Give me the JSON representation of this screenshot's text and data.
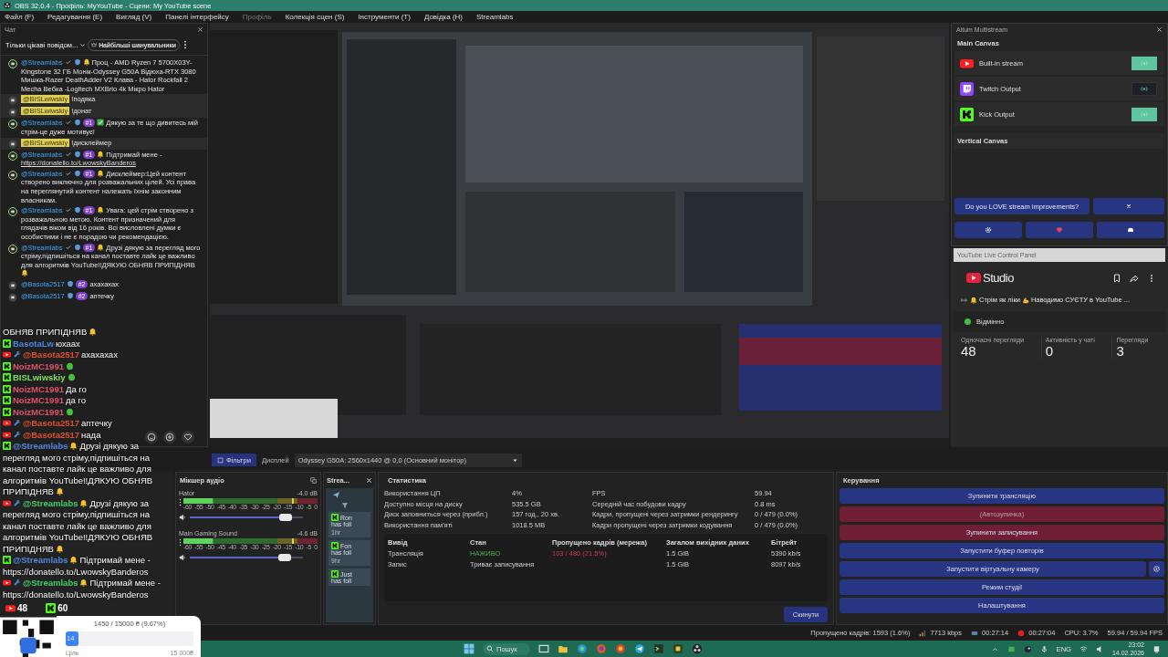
{
  "window": {
    "title": "OBS 32.0.4 - Профіль: MyYouTube - Сцени: My YouTube scene"
  },
  "menu": [
    {
      "label": "Файл (F)",
      "disabled": false
    },
    {
      "label": "Редагування (E)",
      "disabled": false
    },
    {
      "label": "Вигляд (V)",
      "disabled": false
    },
    {
      "label": "Панелі інтерфейсу",
      "disabled": false
    },
    {
      "label": "Профіль",
      "disabled": true
    },
    {
      "label": "Колекція сцен (S)",
      "disabled": false
    },
    {
      "label": "Інструменти (T)",
      "disabled": false
    },
    {
      "label": "Довідка (H)",
      "disabled": false
    },
    {
      "label": "Streamlabs",
      "disabled": false
    }
  ],
  "chat": {
    "title": "Чат",
    "filter": "Тільки цікаві повідом...",
    "chip": "Найбільші шанувальники",
    "messages": [
      {
        "kind": "bot",
        "name": "@Streamlabs",
        "bell": true,
        "text": "Проц - AMD Ryzen 7 5700X03Y-Kingstone 32 ГБ Монік-Odyssey G50A Відюха-RTX 3080 Мишка-Razer DeathAdder V2 Клава - Hator Rockfall 2 Mecha Вебка -Logitech MXBrio 4k Мікро Hator"
      },
      {
        "kind": "viewer",
        "name": "@BISLwiwskiy",
        "text": "!подяка"
      },
      {
        "kind": "viewer",
        "name": "@BISLwiwskiy",
        "text": "!донат"
      },
      {
        "kind": "bot",
        "name": "@Streamlabs",
        "badge": "#1",
        "tick": true,
        "text": "Дякую за те що дивитесь мій стрім-це дуже мотивує!"
      },
      {
        "kind": "viewer",
        "name": "@BISLwiwskiy",
        "text": "!дисклеймер"
      },
      {
        "kind": "bot",
        "name": "@Streamlabs",
        "badge": "#1",
        "bell": true,
        "text": "Підтримай мене -",
        "link": "https://donatello.to/LwowskyBanderos"
      },
      {
        "kind": "bot",
        "name": "@Streamlabs",
        "badge": "#1",
        "bell": true,
        "text": "Дисклеймер:Цей контент створено виключно для розважальних цілей. Усі права на переглянутий контент належать їхнім законним власникам."
      },
      {
        "kind": "bot",
        "name": "@Streamlabs",
        "badge": "#1",
        "bell": true,
        "text": "Увага: цей стрім створено з розважальною метою. Контент призначений для глядачів віком від 16 років. Всі висловлені думки є особистими і не є порадою чи рекомендацією."
      },
      {
        "kind": "bot",
        "name": "@Streamlabs",
        "badge": "#1",
        "bell": true,
        "text": "Друзі дякую за перегляд мого стріму,підпишіться на канал поставте лайк це важливо для алгоритмів YouTube!!ДЯКУЮ ОБНЯВ ПРИПІДНЯВ",
        "bell_end": true
      },
      {
        "kind": "member",
        "name": "@Basota2517",
        "badge": "#2",
        "text": "ахахахах"
      },
      {
        "kind": "member",
        "name": "@Basota2517",
        "badge": "#2",
        "text": "аптечку"
      }
    ]
  },
  "overlay": {
    "lines": [
      {
        "kind": "plain",
        "text": "ОБНЯВ ПРИПІДНЯВ",
        "bell_end": true
      },
      {
        "kind": "kick",
        "name": "BasotaLw",
        "color": "#4f86e0",
        "text": "юхаах"
      },
      {
        "kind": "youtube",
        "mod": true,
        "name": "@Basota2517",
        "color": "#e0502a",
        "text": "ахахахах"
      },
      {
        "kind": "kick",
        "name": "NoizMC1991",
        "color": "#e0506e",
        "sticker": true
      },
      {
        "kind": "kick",
        "name": "BISLwiwskiy",
        "color": "#7fe05a",
        "sticker": true
      },
      {
        "kind": "kick",
        "name": "NoizMC1991",
        "color": "#e0506e",
        "text": "Да го"
      },
      {
        "kind": "kick",
        "name": "NoizMC1991",
        "color": "#e0506e",
        "text": "да го"
      },
      {
        "kind": "kick",
        "name": "NoizMC1991",
        "color": "#e0506e",
        "sticker": true
      },
      {
        "kind": "youtube",
        "mod": true,
        "name": "@Basota2517",
        "color": "#e0502a",
        "text": "аптечку"
      },
      {
        "kind": "youtube",
        "mod": true,
        "name": "@Basota2517",
        "color": "#e0502a",
        "text": "нада"
      },
      {
        "kind": "kick",
        "name": "@Streamlabs",
        "color": "#4f86e0",
        "bell": true,
        "text": "Друзі дякую за перегляд мого стріму,підпишіться на канал поставте лайк це важливо для алгоритмів YouTube!!ДЯКУЮ ОБНЯВ ПРИПІДНЯВ",
        "bell_end": true
      },
      {
        "kind": "youtube",
        "mod": true,
        "name": "@Streamlabs",
        "color": "#3fcf6a",
        "bell": true,
        "text": "Друзі дякую за перегляд мого стріму,підпишіться на канал поставте лайк це важливо для алгоритмів YouTube!!ДЯКУЮ ОБНЯВ ПРИПІДНЯВ",
        "bell_end": true
      },
      {
        "kind": "kick",
        "name": "@Streamlabs",
        "color": "#4f86e0",
        "bell": true,
        "text": "Підтримай мене - https://donatello.to/LwowskyBanderos"
      },
      {
        "kind": "youtube",
        "mod": true,
        "name": "@Streamlabs",
        "color": "#3fcf6a",
        "bell": true,
        "text": "Підтримай мене - https://donatello.to/LwowskyBanderos"
      }
    ],
    "counts": [
      {
        "kind": "youtube",
        "value": "48"
      },
      {
        "kind": "kick",
        "value": "60"
      }
    ],
    "goal": {
      "progress": "1450 / 15000 ₴ (9.67%)",
      "level": 0.0967,
      "bar_label": "14",
      "goal_label": "Ціль",
      "goal_value": "15 000₴"
    }
  },
  "multistream": {
    "title": "Aitum Multistream",
    "main_canvas": "Main Canvas",
    "outputs": [
      {
        "name": "Built-in stream",
        "kind": "youtube",
        "on": true
      },
      {
        "name": "Twitch Output",
        "kind": "twitch",
        "on": false
      },
      {
        "name": "Kick Output",
        "kind": "kick",
        "on": true
      }
    ],
    "vertical_canvas": "Vertical Canvas",
    "promo": "Do you LOVE stream improvements?"
  },
  "youtube": {
    "title": "YouTube Live Control Panel",
    "logo_text": "Studio",
    "stream_title": [
      {
        "kind": "bell"
      },
      {
        "kind": "text",
        "text": "Стрім як ліки"
      },
      {
        "kind": "arm"
      },
      {
        "kind": "text",
        "text": "Наводимо СУЄТУ в YouTube ..."
      }
    ],
    "health": "Відмінно",
    "stats": [
      {
        "label": "Одночасні перегляди",
        "value": "48"
      },
      {
        "label": "Активність у чаті",
        "value": "0"
      },
      {
        "label": "Перегляди",
        "value": "3"
      }
    ]
  },
  "display_bar": {
    "filters": "Фільтри",
    "label": "Дисплей",
    "value": "Odyssey G50A: 2560x1440 @ 0,0 (Основний монітор)"
  },
  "mixer": {
    "title": "Мікшер аудіо",
    "channels": [
      {
        "name": "Hator",
        "reading": "-4.0 dB",
        "level": 0.85,
        "scale": [
          "-60",
          "-55",
          "-50",
          "-45",
          "-40",
          "-35",
          "-30",
          "-25",
          "-20",
          "-15",
          "-10",
          "-5",
          "0"
        ]
      },
      {
        "name": "Main Gaming Sound",
        "reading": "-4.6 dB",
        "level": 0.84,
        "scale": [
          "-60",
          "-55",
          "-50",
          "-45",
          "-40",
          "-35",
          "-30",
          "-25",
          "-20",
          "-15",
          "-10",
          "-5",
          "0"
        ]
      }
    ]
  },
  "events": {
    "title": "Strea...",
    "items": [
      {
        "name": "Ron",
        "text": "has foll",
        "time": "1hr"
      },
      {
        "name": "Fon",
        "text": "has foll",
        "time": "9hr"
      },
      {
        "name": "Just",
        "text": "has foll"
      }
    ]
  },
  "stats": {
    "title": "Статистика",
    "left": [
      {
        "label": "Використання ЦП",
        "value": "4%"
      },
      {
        "label": "Доступно місця на диску",
        "value": "535.5 GB"
      },
      {
        "label": "Диск заповниться через (прибл.)",
        "value": "157 год., 20 хв."
      },
      {
        "label": "Використання пам'яті",
        "value": "1018.5 MB"
      }
    ],
    "right": [
      {
        "label": "FPS",
        "value": "59.94"
      },
      {
        "label": "Середній час побудови кадру",
        "value": "0.8 ms"
      },
      {
        "label": "Кадри, пропущені через затримки рендерингу",
        "value": "0 / 479 (0.0%)"
      },
      {
        "label": "Кадри пропущені через затримки кодування",
        "value": "0 / 479 (0.0%)"
      }
    ],
    "columns": [
      "Вивід",
      "Стан",
      "Пропущено кадрів (мережа)",
      "Загалом вихідних даних",
      "Бітрейт"
    ],
    "rows": [
      {
        "name": "Трансляція",
        "state": "НАЖИВО",
        "live": true,
        "dropped": "103 / 480 (21.5%)",
        "total": "1.5 GiB",
        "bitrate": "5390 kb/s"
      },
      {
        "name": "Запис",
        "state": "Триває записування",
        "live": false,
        "total": "1.5 GiB",
        "bitrate": "8097 kb/s"
      }
    ],
    "reset": "Скинути"
  },
  "controls": {
    "title": "Керування",
    "buttons": [
      {
        "label": "Зупинити трансляцію",
        "active": false,
        "disabled": false
      },
      {
        "label": "(Автозупинка)",
        "active": true,
        "disabled": true
      },
      {
        "label": "Зупинити записування",
        "active": true,
        "disabled": false
      },
      {
        "label": "Запустити буфер повторів",
        "active": false,
        "disabled": false
      },
      {
        "label": "Запустити віртуальну камеру",
        "active": false,
        "disabled": false,
        "settings": true
      },
      {
        "label": "Режим студії",
        "active": false,
        "disabled": false
      },
      {
        "label": "Налаштування",
        "active": false,
        "disabled": false
      }
    ]
  },
  "status_bar": {
    "dropped": "Пропущено кадрів: 1593 (1.6%)",
    "bitrate": "7713 kbps",
    "stream_time": "00:27:14",
    "record_time": "00:27:04",
    "cpu": "CPU: 3.7%",
    "fps": "59.94 / 59.94 FPS"
  },
  "taskbar": {
    "search": "Пошук",
    "lang": "ENG",
    "time": "23:02",
    "date": "14.02.2026"
  }
}
